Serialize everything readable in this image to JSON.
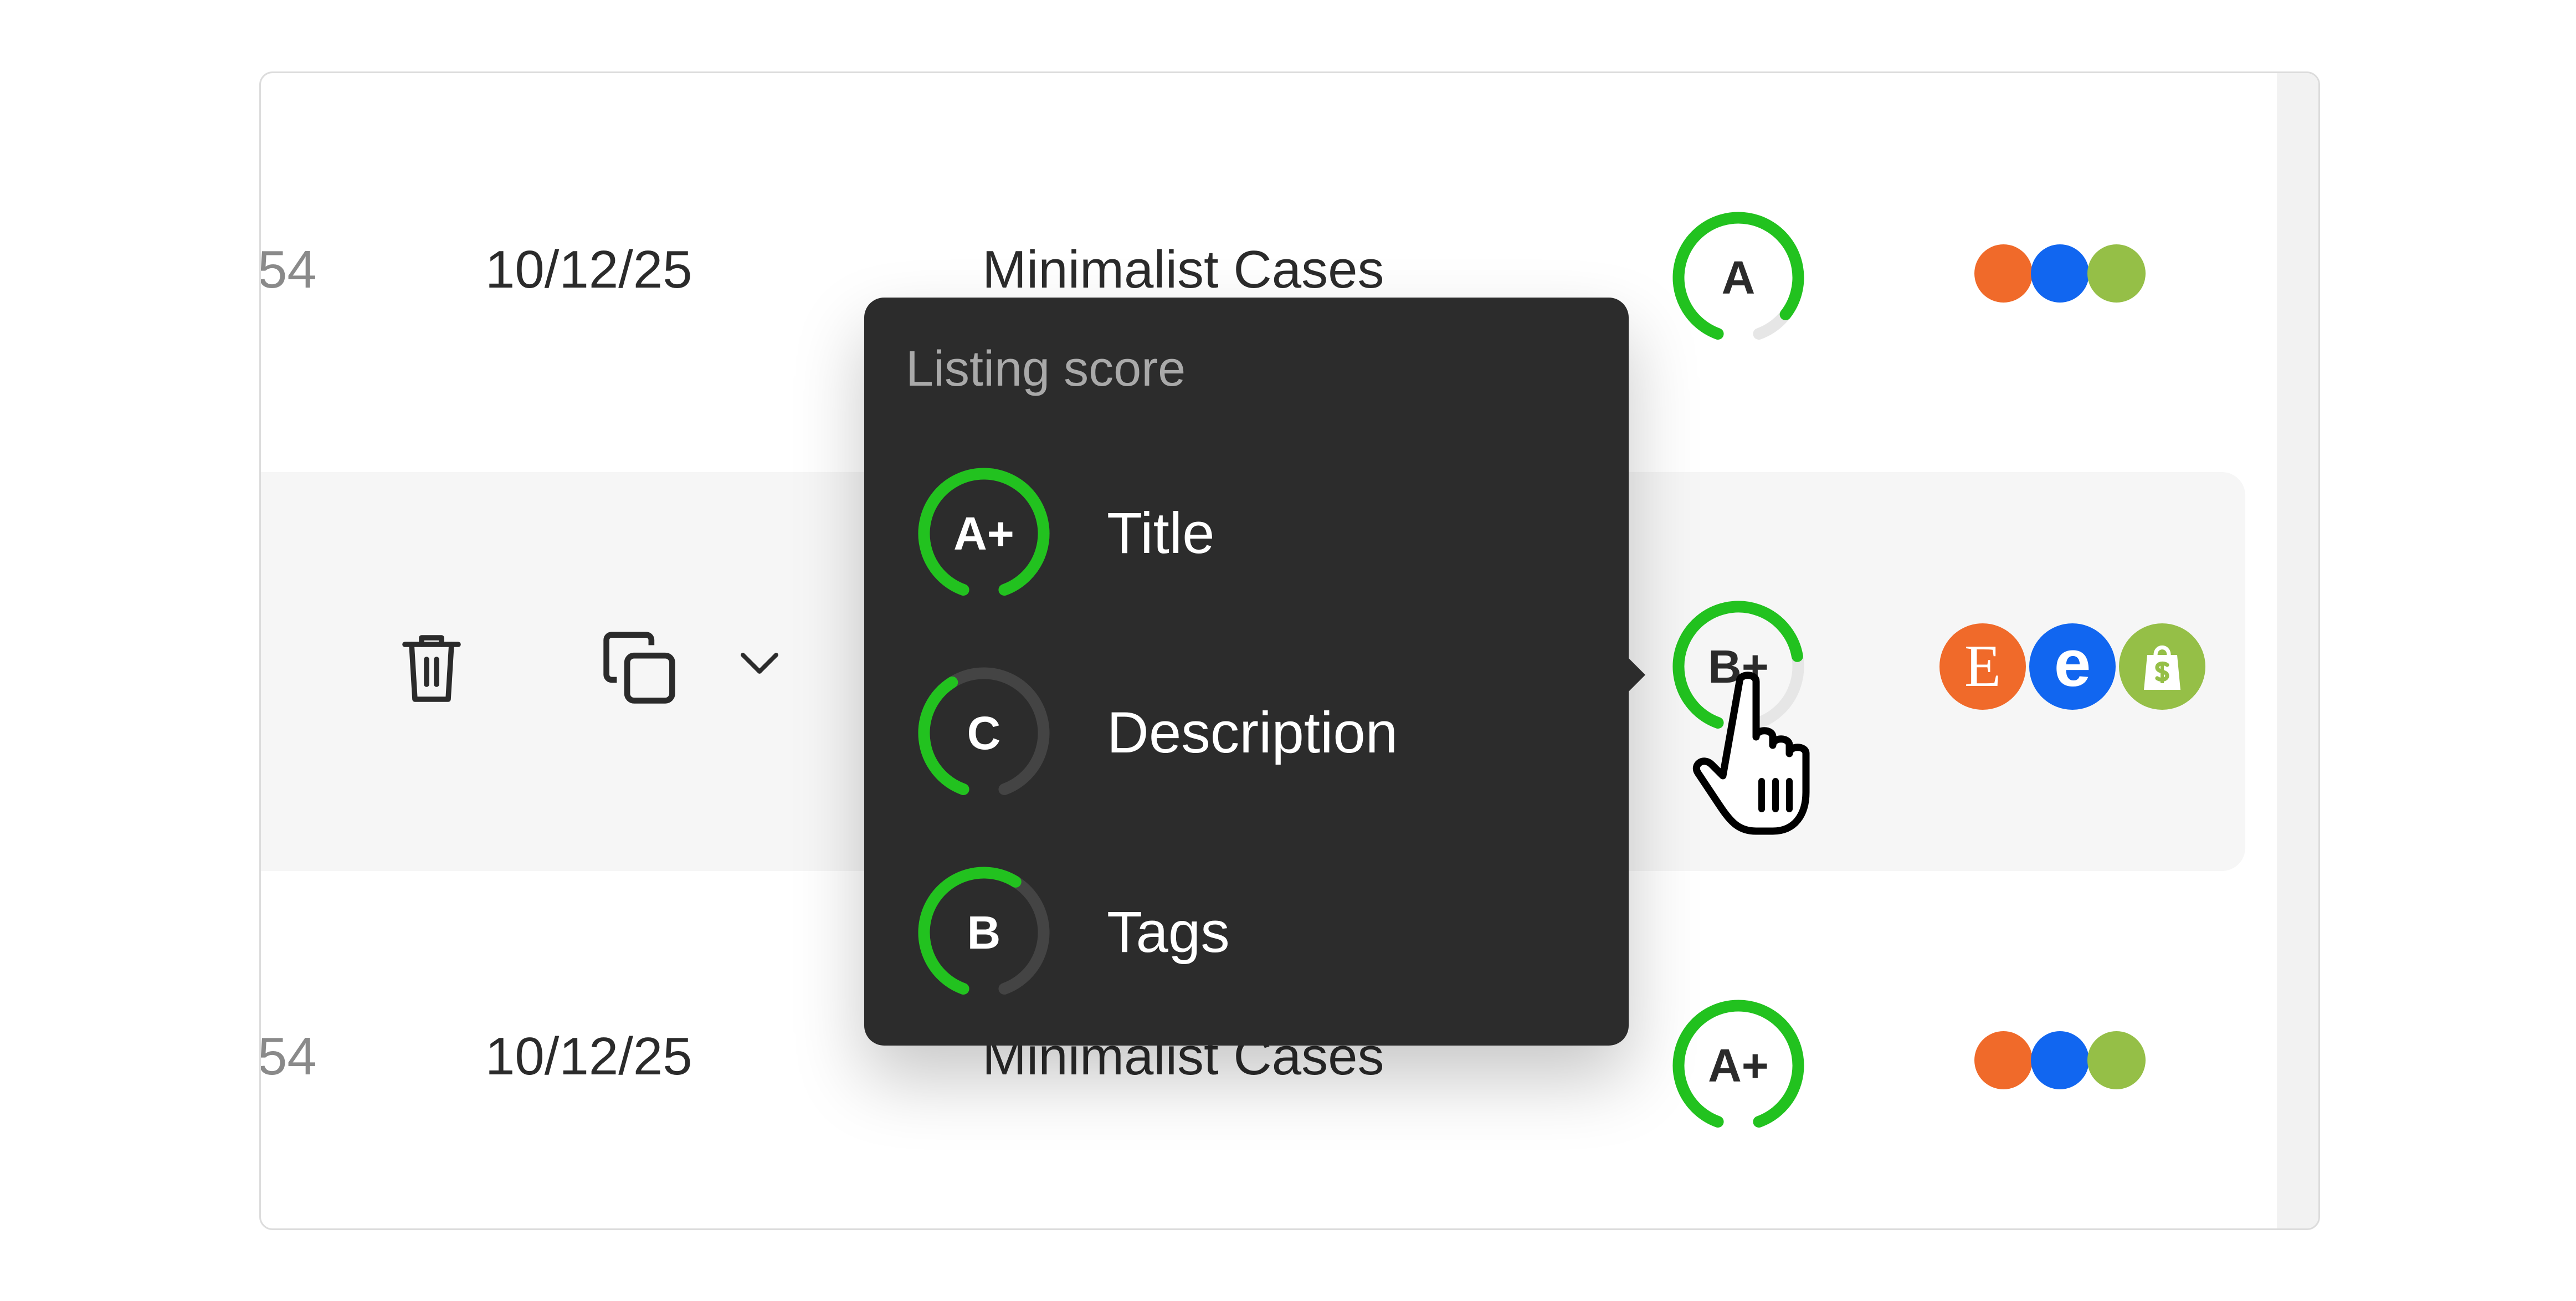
{
  "rows": [
    {
      "id": "54",
      "date": "10/12/25",
      "collection": "Minimalist Cases",
      "grade": "A",
      "grade_progress": 0.9
    },
    {
      "grade": "B+",
      "grade_progress": 0.75
    },
    {
      "id": "54",
      "date": "10/12/25",
      "collection": "Minimalist Cases",
      "grade": "A+",
      "grade_progress": 1.0
    }
  ],
  "row_actions": {
    "delete_icon": "trash-icon",
    "duplicate_icon": "copy-icon",
    "more_icon": "chevron-down-icon"
  },
  "channels": {
    "etsy_letter": "E",
    "ebay_letter": "e",
    "shopify_icon": "shopify-bag-icon"
  },
  "channel_dot_colors": [
    "#f06a2a",
    "#1166f0",
    "#95bf47"
  ],
  "tooltip": {
    "title": "Listing score",
    "items": [
      {
        "grade": "A+",
        "name": "Title",
        "progress": 1.0
      },
      {
        "grade": "C",
        "name": "Description",
        "progress": 0.4
      },
      {
        "grade": "B",
        "name": "Tags",
        "progress": 0.6
      }
    ]
  },
  "colors": {
    "score_green": "#22c21f",
    "score_track_light": "#e6e6e6",
    "score_track_dark": "#444444",
    "tooltip_bg": "#2c2c2c"
  }
}
